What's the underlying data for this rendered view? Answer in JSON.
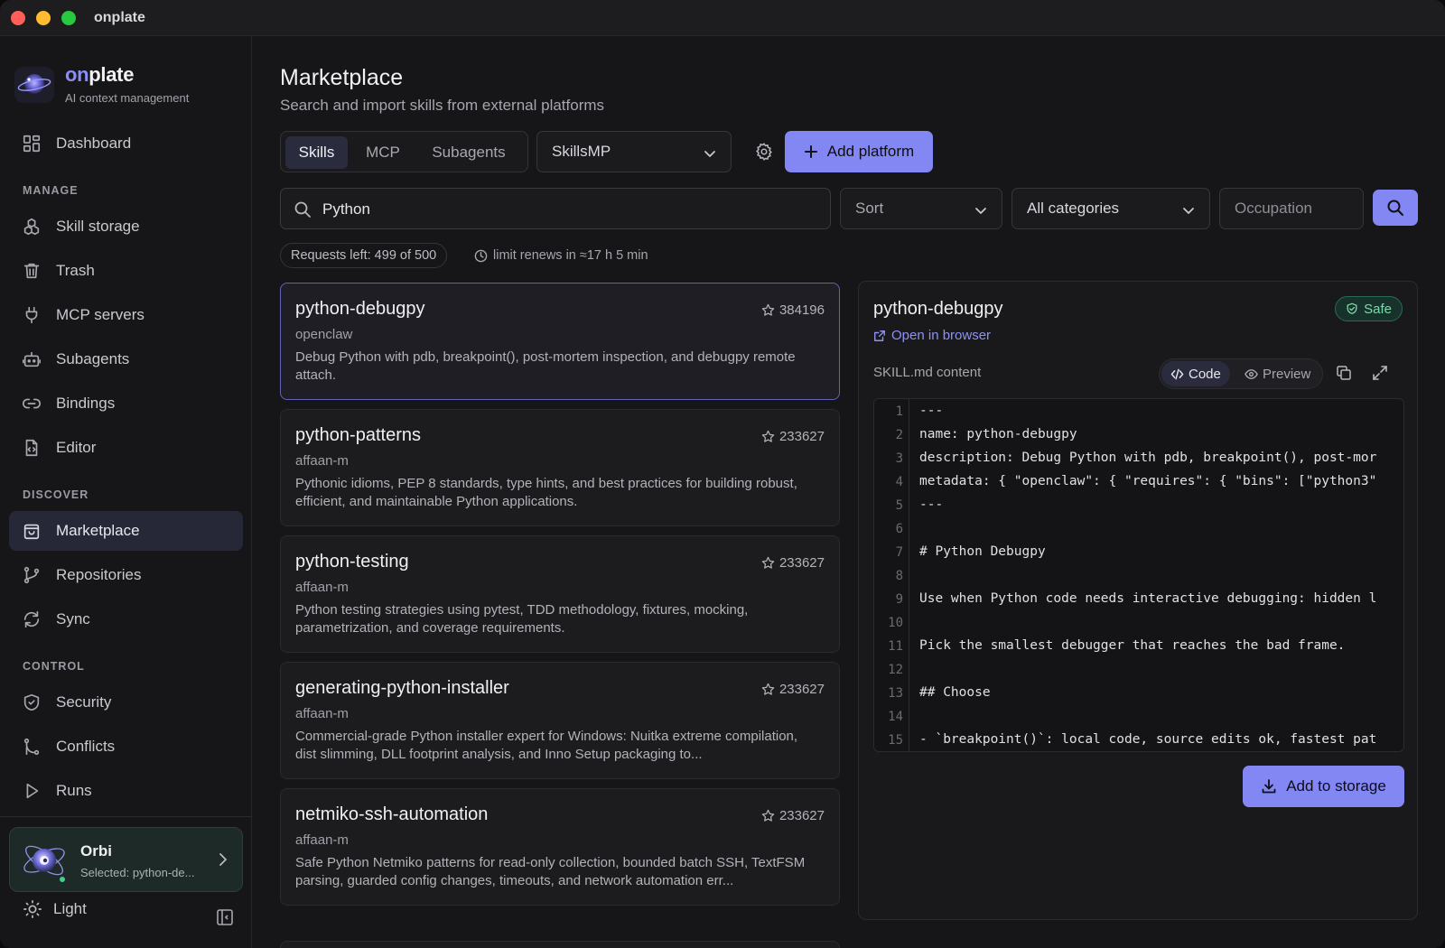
{
  "window": {
    "title": "onplate"
  },
  "brand": {
    "on": "on",
    "rest": "plate",
    "subtitle": "AI context management"
  },
  "nav": {
    "dashboard": "Dashboard",
    "section_manage": "MANAGE",
    "skill_storage": "Skill storage",
    "trash": "Trash",
    "mcp_servers": "MCP servers",
    "subagents": "Subagents",
    "bindings": "Bindings",
    "editor": "Editor",
    "section_discover": "DISCOVER",
    "marketplace": "Marketplace",
    "repositories": "Repositories",
    "sync": "Sync",
    "section_control": "CONTROL",
    "security": "Security",
    "conflicts": "Conflicts",
    "runs": "Runs"
  },
  "orbi": {
    "name": "Orbi",
    "status": "Selected: python-de..."
  },
  "theme": {
    "label": "Light"
  },
  "page": {
    "title": "Marketplace",
    "subtitle": "Search and import skills from external platforms"
  },
  "tabs": [
    "Skills",
    "MCP",
    "Subagents"
  ],
  "platform": {
    "selected": "SkillsMP"
  },
  "add_platform": "Add platform",
  "search": {
    "value": "Python"
  },
  "sort": {
    "label": "Sort"
  },
  "categories": {
    "selected": "All categories"
  },
  "occupation": {
    "placeholder": "Occupation"
  },
  "requests": {
    "text": "Requests left: 499 of 500",
    "renew": "limit renews in ≈17 h 5 min"
  },
  "results": [
    {
      "title": "python-debugpy",
      "stars": "384196",
      "author": "openclaw",
      "desc": "Debug Python with pdb, breakpoint(), post-mortem inspection, and debugpy remote attach."
    },
    {
      "title": "python-patterns",
      "stars": "233627",
      "author": "affaan-m",
      "desc": "Pythonic idioms, PEP 8 standards, type hints, and best practices for building robust, efficient, and maintainable Python applications."
    },
    {
      "title": "python-testing",
      "stars": "233627",
      "author": "affaan-m",
      "desc": "Python testing strategies using pytest, TDD methodology, fixtures, mocking, parametrization, and coverage requirements."
    },
    {
      "title": "generating-python-installer",
      "stars": "233627",
      "author": "affaan-m",
      "desc": "Commercial-grade Python installer expert for Windows: Nuitka extreme compilation, dist slimming, DLL footprint analysis, and Inno Setup packaging to..."
    },
    {
      "title": "netmiko-ssh-automation",
      "stars": "233627",
      "author": "affaan-m",
      "desc": "Safe Python Netmiko patterns for read-only collection, bounded batch SSH, TextFSM parsing, guarded config changes, timeouts, and network automation err..."
    }
  ],
  "detail": {
    "title": "python-debugpy",
    "badge": "Safe",
    "open_link": "Open in browser",
    "content_label": "SKILL.md content",
    "view_code": "Code",
    "view_preview": "Preview",
    "add_button": "Add to storage",
    "code_lines": [
      "---",
      "name: python-debugpy",
      "description: Debug Python with pdb, breakpoint(), post-mor",
      "metadata: { \"openclaw\": { \"requires\": { \"bins\": [\"python3\"",
      "---",
      "",
      "# Python Debugpy",
      "",
      "Use when Python code needs interactive debugging: hidden l",
      "",
      "Pick the smallest debugger that reaches the bad frame.",
      "",
      "## Choose",
      "",
      "- `breakpoint()`: local code, source edits ok, fastest pat"
    ],
    "line_numbers": [
      "1",
      "2",
      "3",
      "4",
      "5",
      "6",
      "7",
      "8",
      "9",
      "10",
      "11",
      "12",
      "13",
      "14",
      "15"
    ]
  },
  "colors": {
    "accent": "#8387f3",
    "safe": "#7fd9ad",
    "background": "#161619"
  }
}
